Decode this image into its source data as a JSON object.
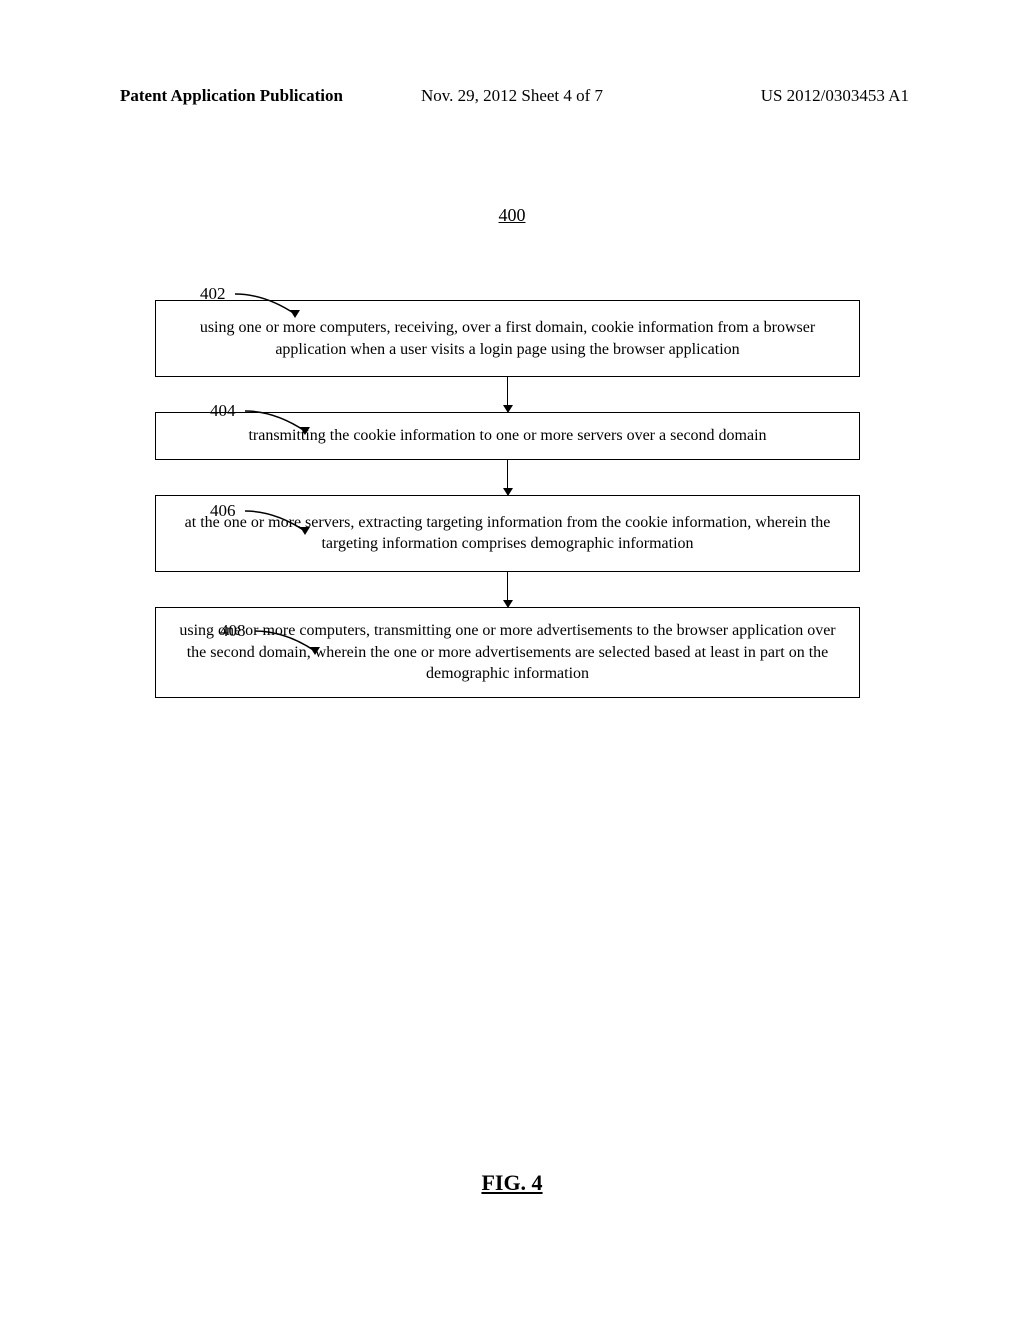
{
  "header": {
    "left": "Patent Application Publication",
    "center": "Nov. 29, 2012  Sheet 4 of 7",
    "right": "US 2012/0303453 A1"
  },
  "figure": {
    "number": "400",
    "title": "FIG. 4"
  },
  "steps": [
    {
      "label": "402",
      "text": "using one or more computers, receiving, over a first domain, cookie information from a browser application when a user visits a login page using the browser application"
    },
    {
      "label": "404",
      "text": "transmitting the cookie information to one or more servers over a second domain"
    },
    {
      "label": "406",
      "text": "at the one or more servers, extracting targeting information from the cookie information, wherein the targeting information comprises demographic information"
    },
    {
      "label": "408",
      "text": "using one or more computers, transmitting one or more advertisements to the browser application over the second domain, wherein the one or more advertisements are selected based at least in part on the demographic information"
    }
  ]
}
